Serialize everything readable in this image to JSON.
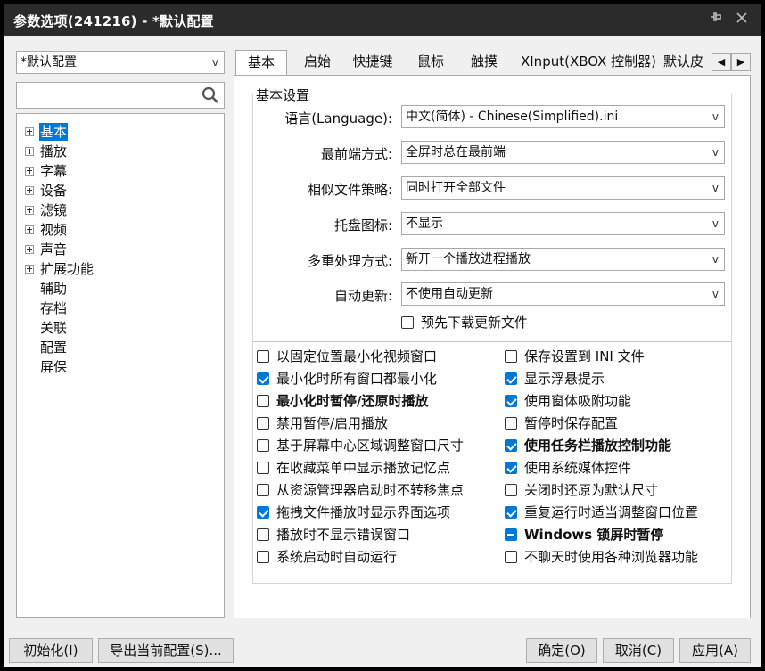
{
  "window": {
    "title": "参数选项(241216) - *默认配置"
  },
  "profile_select": {
    "value": "*默认配置"
  },
  "search": {
    "placeholder": ""
  },
  "tree": {
    "items": [
      {
        "label": "基本",
        "expandable": true,
        "selected": true
      },
      {
        "label": "播放",
        "expandable": true
      },
      {
        "label": "字幕",
        "expandable": true
      },
      {
        "label": "设备",
        "expandable": true
      },
      {
        "label": "滤镜",
        "expandable": true
      },
      {
        "label": "视频",
        "expandable": true
      },
      {
        "label": "声音",
        "expandable": true
      },
      {
        "label": "扩展功能",
        "expandable": true
      },
      {
        "label": "辅助",
        "expandable": false
      },
      {
        "label": "存档",
        "expandable": false
      },
      {
        "label": "关联",
        "expandable": false
      },
      {
        "label": "配置",
        "expandable": false
      },
      {
        "label": "屏保",
        "expandable": false
      }
    ]
  },
  "tabs": [
    "基本",
    "启始",
    "快捷键",
    "鼠标",
    "触摸",
    "XInput(XBOX 控制器)",
    "默认皮"
  ],
  "group_title": "基本设置",
  "fields": [
    {
      "label": "语言(Language):",
      "value": "中文(简体) - Chinese(Simplified).ini"
    },
    {
      "label": "最前端方式:",
      "value": "全屏时总在最前端"
    },
    {
      "label": "相似文件策略:",
      "value": "同时打开全部文件"
    },
    {
      "label": "托盘图标:",
      "value": "不显示"
    },
    {
      "label": "多重处理方式:",
      "value": "新开一个播放进程播放"
    },
    {
      "label": "自动更新:",
      "value": "不使用自动更新"
    }
  ],
  "predownload": {
    "label": "预先下载更新文件",
    "checked": false
  },
  "options_left": [
    {
      "label": "以固定位置最小化视频窗口",
      "state": "unchecked"
    },
    {
      "label": "最小化时所有窗口都最小化",
      "state": "checked"
    },
    {
      "label": "最小化时暂停/还原时播放",
      "state": "unchecked",
      "bold": true
    },
    {
      "label": "禁用暂停/启用播放",
      "state": "unchecked"
    },
    {
      "label": "基于屏幕中心区域调整窗口尺寸",
      "state": "unchecked"
    },
    {
      "label": "在收藏菜单中显示播放记忆点",
      "state": "unchecked"
    },
    {
      "label": "从资源管理器启动时不转移焦点",
      "state": "unchecked"
    },
    {
      "label": "拖拽文件播放时显示界面选项",
      "state": "checked"
    },
    {
      "label": "播放时不显示错误窗口",
      "state": "unchecked"
    },
    {
      "label": "系统启动时自动运行",
      "state": "unchecked"
    }
  ],
  "options_right": [
    {
      "label": "保存设置到 INI 文件",
      "state": "unchecked"
    },
    {
      "label": "显示浮悬提示",
      "state": "checked"
    },
    {
      "label": "使用窗体吸附功能",
      "state": "checked"
    },
    {
      "label": "暂停时保存配置",
      "state": "unchecked"
    },
    {
      "label": "使用任务栏播放控制功能",
      "state": "checked",
      "bold": true
    },
    {
      "label": "使用系统媒体控件",
      "state": "checked"
    },
    {
      "label": "关闭时还原为默认尺寸",
      "state": "unchecked"
    },
    {
      "label": "重复运行时适当调整窗口位置",
      "state": "checked"
    },
    {
      "label": "Windows 锁屏时暂停",
      "state": "indeterminate",
      "bold": true
    },
    {
      "label": "不聊天时使用各种浏览器功能",
      "state": "unchecked"
    }
  ],
  "buttons": {
    "init": "初始化(I)",
    "export": "导出当前配置(S)...",
    "ok": "确定(O)",
    "cancel": "取消(C)",
    "apply": "应用(A)"
  },
  "icons": {
    "pin": "pin-icon",
    "close": "close-icon",
    "search": "search-icon",
    "dropdown": "chevron-down-icon"
  },
  "colors": {
    "accent": "#0078d7",
    "titlebar": "#2b2b2b"
  }
}
